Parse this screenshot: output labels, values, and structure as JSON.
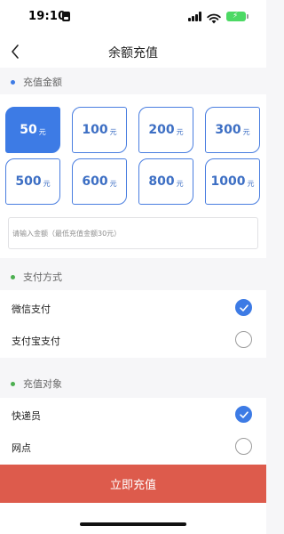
{
  "status_bar": {
    "time": "19:10",
    "battery_color": "#4cd964"
  },
  "nav": {
    "title": "余额充值",
    "back_icon": "chevron-left-icon"
  },
  "recharge_amount": {
    "section_title": "充值金额",
    "dot_color": "#3d7be5",
    "options": [
      {
        "value": "50",
        "unit": "元",
        "selected": true
      },
      {
        "value": "100",
        "unit": "元",
        "selected": false
      },
      {
        "value": "200",
        "unit": "元",
        "selected": false
      },
      {
        "value": "300",
        "unit": "元",
        "selected": false
      },
      {
        "value": "500",
        "unit": "元",
        "selected": false
      },
      {
        "value": "600",
        "unit": "元",
        "selected": false
      },
      {
        "value": "800",
        "unit": "元",
        "selected": false
      },
      {
        "value": "1000",
        "unit": "元",
        "selected": false
      }
    ],
    "custom_placeholder": "请输入金额（最低充值金额30元）"
  },
  "payment_method": {
    "section_title": "支付方式",
    "dot_color": "#4caf50",
    "options": [
      {
        "label": "微信支付",
        "checked": true
      },
      {
        "label": "支付宝支付",
        "checked": false
      }
    ]
  },
  "recharge_target": {
    "section_title": "充值对象",
    "dot_color": "#4caf50",
    "options": [
      {
        "label": "快递员",
        "checked": true
      },
      {
        "label": "网点",
        "checked": false
      }
    ]
  },
  "submit": {
    "label": "立即充值",
    "color": "#dd5b4c"
  },
  "accent_color": "#3d7be5"
}
